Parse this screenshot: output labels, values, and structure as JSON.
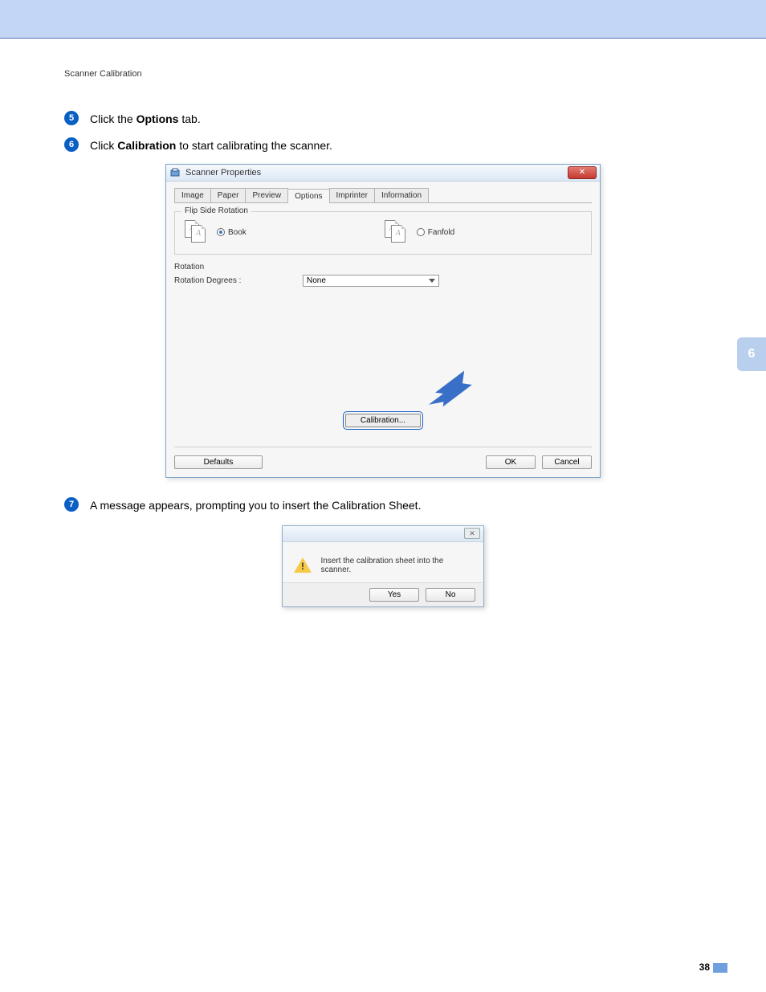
{
  "section_title": "Scanner Calibration",
  "side_tab_number": "6",
  "page_number": "38",
  "steps": {
    "s5": {
      "num": "5",
      "prefix": "Click the ",
      "bold": "Options",
      "suffix": " tab."
    },
    "s6": {
      "num": "6",
      "prefix": "Click ",
      "bold": "Calibration",
      "suffix": " to start calibrating the scanner."
    },
    "s7": {
      "num": "7",
      "text": "A message appears, prompting you to insert the Calibration Sheet."
    }
  },
  "window": {
    "title": "Scanner Properties",
    "close": "✕",
    "tabs": [
      "Image",
      "Paper",
      "Preview",
      "Options",
      "Imprinter",
      "Information"
    ],
    "active_tab_index": 3,
    "flip_legend": "Flip Side Rotation",
    "flip_book": "Book",
    "flip_fanfold": "Fanfold",
    "rotation_heading": "Rotation",
    "rotation_label": "Rotation Degrees :",
    "rotation_value": "None",
    "calibration_btn": "Calibration...",
    "defaults_btn": "Defaults",
    "ok_btn": "OK",
    "cancel_btn": "Cancel"
  },
  "dialog": {
    "close": "✕",
    "message": "Insert the calibration sheet into the scanner.",
    "yes": "Yes",
    "no": "No"
  }
}
